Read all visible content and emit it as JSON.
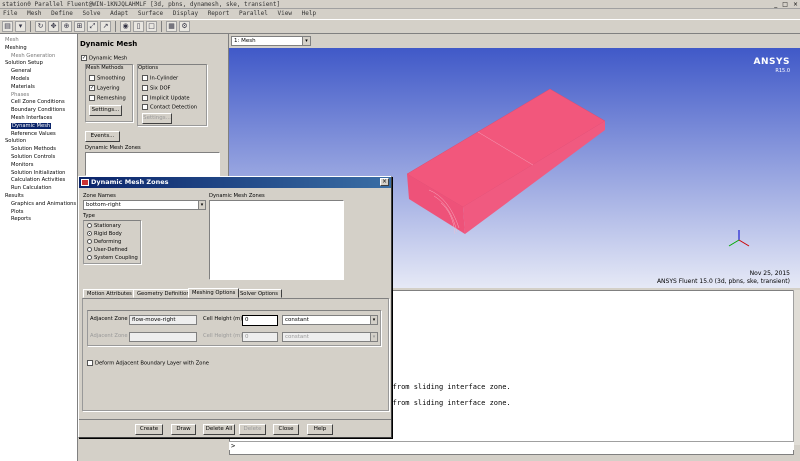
{
  "window": {
    "title": "station0 Parallel Fluent@WIN-1KNJQLAHMLF  [3d, pbns, dynamesh, ske, transient]",
    "controls": [
      "_",
      "□",
      "×"
    ]
  },
  "menubar": [
    "File",
    "Mesh",
    "Define",
    "Solve",
    "Adapt",
    "Surface",
    "Display",
    "Report",
    "Parallel",
    "View",
    "Help"
  ],
  "toolbar": {
    "icons": [
      "open-icon",
      "save-icon",
      "rotate-icon",
      "pan-icon",
      "zoom-in-icon",
      "zoom-box-icon",
      "fit-icon",
      "probe-icon",
      "camera-icon",
      "layout-icon",
      "window-icon",
      "axes-icon"
    ]
  },
  "tree": {
    "items": [
      {
        "label": "Mesh",
        "level": 0,
        "gray": true
      },
      {
        "label": "Meshing",
        "level": 0
      },
      {
        "label": "Mesh Generation",
        "level": 1,
        "gray": true
      },
      {
        "label": "Solution Setup",
        "level": 0
      },
      {
        "label": "General",
        "level": 1
      },
      {
        "label": "Models",
        "level": 1
      },
      {
        "label": "Materials",
        "level": 1
      },
      {
        "label": "Phases",
        "level": 1,
        "gray": true
      },
      {
        "label": "Cell Zone Conditions",
        "level": 1
      },
      {
        "label": "Boundary Conditions",
        "level": 1
      },
      {
        "label": "Mesh Interfaces",
        "level": 1
      },
      {
        "label": "Dynamic Mesh",
        "level": 1,
        "selected": true
      },
      {
        "label": "Reference Values",
        "level": 1
      },
      {
        "label": "Solution",
        "level": 0
      },
      {
        "label": "Solution Methods",
        "level": 1
      },
      {
        "label": "Solution Controls",
        "level": 1
      },
      {
        "label": "Monitors",
        "level": 1
      },
      {
        "label": "Solution Initialization",
        "level": 1
      },
      {
        "label": "Calculation Activities",
        "level": 1
      },
      {
        "label": "Run Calculation",
        "level": 1
      },
      {
        "label": "Results",
        "level": 0
      },
      {
        "label": "Graphics and Animations",
        "level": 1
      },
      {
        "label": "Plots",
        "level": 1
      },
      {
        "label": "Reports",
        "level": 1
      }
    ]
  },
  "taskpage": {
    "title": "Dynamic Mesh",
    "dynamic_mesh_label": "Dynamic Mesh",
    "mesh_methods_label": "Mesh Methods",
    "smoothing": "Smoothing",
    "layering": "Layering",
    "remeshing": "Remeshing",
    "settings": "Settings...",
    "options_label": "Options",
    "in_cylinder": "In-Cylinder",
    "six_dof": "Six DOF",
    "implicit_update": "Implicit Update",
    "contact_detection": "Contact Detection",
    "options_settings": "Settings...",
    "events": "Events...",
    "zones_label": "Dynamic Mesh Zones"
  },
  "graphics": {
    "view_select": "1: Mesh",
    "brand": "ANSYS",
    "version": "R15.0",
    "date": "Nov 25, 2015",
    "info": "ANSYS Fluent 15.0 (3d, pbns, ske, transient)",
    "mesh_color": "#f2577c",
    "bg_top": "#4059c8"
  },
  "console": {
    "lines": [
      "ce from sliding interface zone.",
      "ce from sliding interface zone."
    ],
    "prompt": ">"
  },
  "dialog": {
    "title": "Dynamic Mesh Zones",
    "zone_names_label": "Zone Names",
    "zone_name_value": "bottom-right",
    "dynamic_mesh_zones_label": "Dynamic Mesh Zones",
    "type_label": "Type",
    "types": [
      "Stationary",
      "Rigid Body",
      "Deforming",
      "User-Defined",
      "System Coupling"
    ],
    "tabs": [
      "Motion Attributes",
      "Geometry Definition",
      "Meshing Options",
      "Solver Options"
    ],
    "adjacent_zone_label": "Adjacent Zone",
    "adjacent_zone_value": "flow-move-right",
    "cell_height_label": "Cell Height (m)",
    "cell_height_value": "0",
    "cell_height_mode": "constant",
    "adjacent_zone2_label": "Adjacent Zone",
    "cell_height2_label": "Cell Height (m)",
    "cell_height2_value": "0",
    "cell_height2_mode": "constant",
    "deform_label": "Deform Adjacent Boundary Layer with Zone",
    "buttons": {
      "create": "Create",
      "draw": "Draw",
      "delete_all": "Delete All",
      "delete": "Delete",
      "close": "Close",
      "help": "Help"
    }
  }
}
